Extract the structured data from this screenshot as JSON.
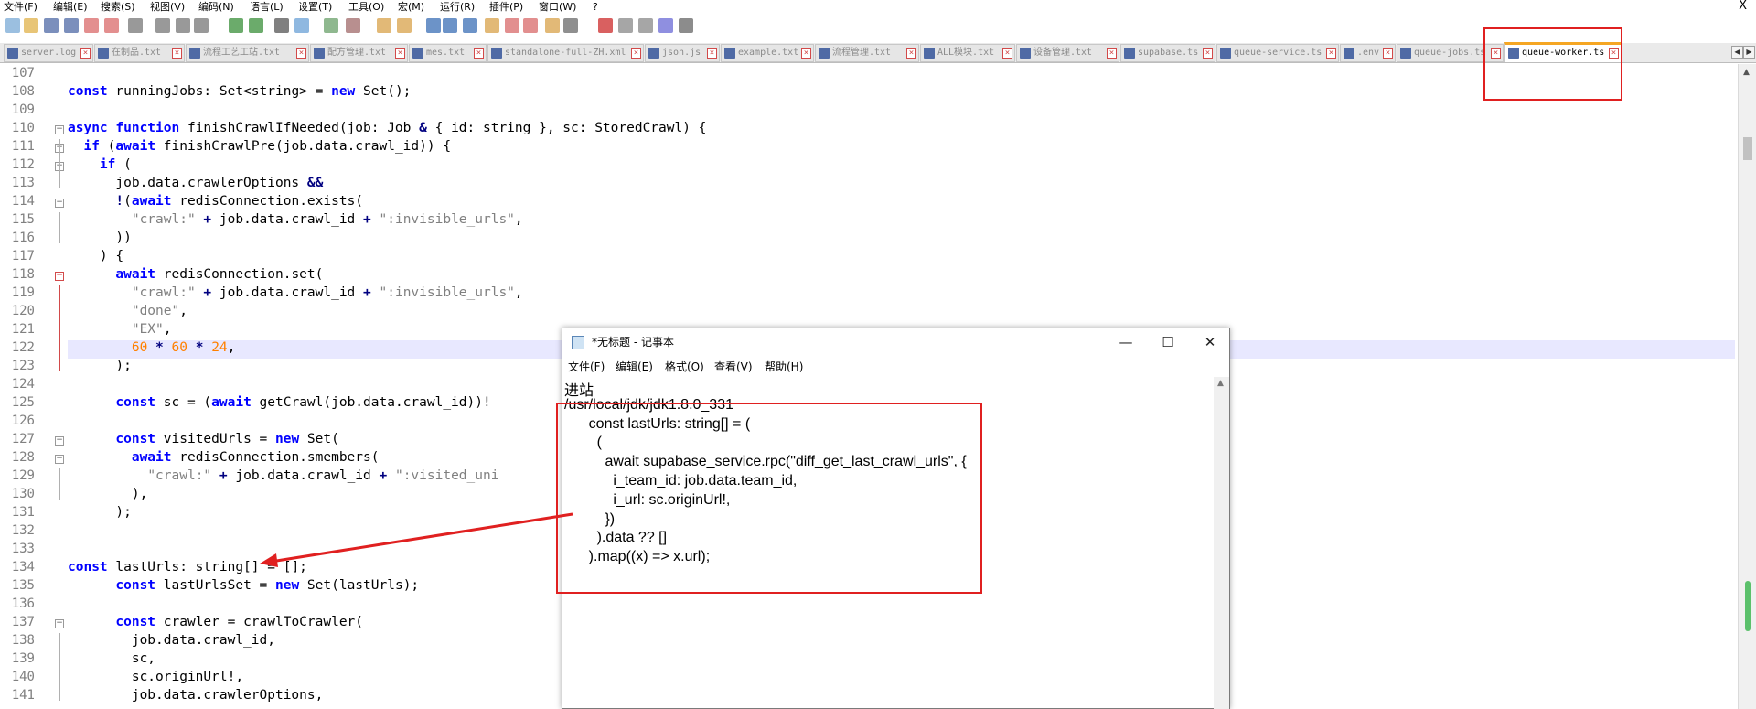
{
  "menu": {
    "items": [
      "文件(F)",
      "编辑(E)",
      "搜索(S)",
      "视图(V)",
      "编码(N)",
      "语言(L)",
      "设置(T)",
      "工具(O)",
      "宏(M)",
      "运行(R)",
      "插件(P)",
      "窗口(W)",
      "?"
    ],
    "close": "X"
  },
  "toolbar": {
    "icons": [
      "new-file-icon",
      "open-file-icon",
      "save-icon",
      "save-all-icon",
      "close-icon",
      "close-all-icon",
      "print-icon",
      "cut-icon",
      "copy-icon",
      "paste-icon",
      "undo-icon",
      "redo-icon",
      "find-icon",
      "replace-icon",
      "zoom-in-icon",
      "zoom-out-icon",
      "sync-v-icon",
      "sync-h-icon",
      "wrap-icon",
      "all-chars-icon",
      "indent-guide-icon",
      "lang-icon",
      "doc-map-icon",
      "func-list-icon",
      "folder-icon",
      "monitor-icon",
      "record-icon",
      "stop-icon",
      "play-icon",
      "play-multi-icon",
      "save-macro-icon"
    ]
  },
  "tabs": [
    {
      "label": "server.log"
    },
    {
      "label": "在制品.txt"
    },
    {
      "label": "流程工艺工站.txt"
    },
    {
      "label": "配方管理.txt"
    },
    {
      "label": "mes.txt"
    },
    {
      "label": "standalone-full-ZH.xml"
    },
    {
      "label": "json.js"
    },
    {
      "label": "example.txt"
    },
    {
      "label": "流程管理.txt"
    },
    {
      "label": "ALL模块.txt"
    },
    {
      "label": "设备管理.txt"
    },
    {
      "label": "supabase.ts"
    },
    {
      "label": "queue-service.ts"
    },
    {
      "label": ".env"
    },
    {
      "label": "queue-jobs.ts"
    },
    {
      "label": "queue-worker.ts"
    }
  ],
  "nav": {
    "left": "◀",
    "right": "▶"
  },
  "line_numbers": [
    "107",
    "108",
    "109",
    "110",
    "111",
    "112",
    "113",
    "114",
    "115",
    "116",
    "117",
    "118",
    "119",
    "120",
    "121",
    "122",
    "123",
    "124",
    "125",
    "126",
    "127",
    "128",
    "129",
    "130",
    "131",
    "132",
    "133",
    "134",
    "135",
    "136",
    "137",
    "138",
    "139",
    "140",
    "141"
  ],
  "code_lines": [
    [],
    [
      {
        "t": "const",
        "c": "kw"
      },
      {
        "t": " runningJobs: Set<string> = "
      },
      {
        "t": "new",
        "c": "kw"
      },
      {
        "t": " Set();"
      }
    ],
    [],
    [
      {
        "t": "async",
        "c": "kw"
      },
      {
        "t": " "
      },
      {
        "t": "function",
        "c": "kw"
      },
      {
        "t": " finishCrawlIfNeeded(job: Job "
      },
      {
        "t": "&",
        "c": "op"
      },
      {
        "t": " { id: string }, sc: StoredCrawl) {"
      }
    ],
    [
      {
        "t": "  "
      },
      {
        "t": "if",
        "c": "kw"
      },
      {
        "t": " ("
      },
      {
        "t": "await",
        "c": "kw"
      },
      {
        "t": " finishCrawlPre(job.data.crawl_id)) {"
      }
    ],
    [
      {
        "t": "    "
      },
      {
        "t": "if",
        "c": "kw"
      },
      {
        "t": " ("
      }
    ],
    [
      {
        "t": "      job.data.crawlerOptions "
      },
      {
        "t": "&&",
        "c": "op"
      }
    ],
    [
      {
        "t": "      "
      },
      {
        "t": "!",
        "c": "op"
      },
      {
        "t": "("
      },
      {
        "t": "await",
        "c": "kw"
      },
      {
        "t": " redisConnection.exists("
      }
    ],
    [
      {
        "t": "        "
      },
      {
        "t": "\"crawl:\"",
        "c": "str"
      },
      {
        "t": " "
      },
      {
        "t": "+",
        "c": "op"
      },
      {
        "t": " job.data.crawl_id "
      },
      {
        "t": "+",
        "c": "op"
      },
      {
        "t": " "
      },
      {
        "t": "\":invisible_urls\"",
        "c": "str"
      },
      {
        "t": ","
      }
    ],
    [
      {
        "t": "      ))"
      }
    ],
    [
      {
        "t": "    ) {"
      }
    ],
    [
      {
        "t": "      "
      },
      {
        "t": "await",
        "c": "kw"
      },
      {
        "t": " redisConnection.set("
      }
    ],
    [
      {
        "t": "        "
      },
      {
        "t": "\"crawl:\"",
        "c": "str"
      },
      {
        "t": " "
      },
      {
        "t": "+",
        "c": "op"
      },
      {
        "t": " job.data.crawl_id "
      },
      {
        "t": "+",
        "c": "op"
      },
      {
        "t": " "
      },
      {
        "t": "\":invisible_urls\"",
        "c": "str"
      },
      {
        "t": ","
      }
    ],
    [
      {
        "t": "        "
      },
      {
        "t": "\"done\"",
        "c": "str"
      },
      {
        "t": ","
      }
    ],
    [
      {
        "t": "        "
      },
      {
        "t": "\"EX\"",
        "c": "str"
      },
      {
        "t": ","
      }
    ],
    [
      {
        "t": "        "
      },
      {
        "t": "60",
        "c": "num"
      },
      {
        "t": " "
      },
      {
        "t": "*",
        "c": "op"
      },
      {
        "t": " "
      },
      {
        "t": "60",
        "c": "num"
      },
      {
        "t": " "
      },
      {
        "t": "*",
        "c": "op"
      },
      {
        "t": " "
      },
      {
        "t": "24",
        "c": "num"
      },
      {
        "t": ","
      }
    ],
    [
      {
        "t": "      );"
      }
    ],
    [],
    [
      {
        "t": "      "
      },
      {
        "t": "const",
        "c": "kw"
      },
      {
        "t": " sc = ("
      },
      {
        "t": "await",
        "c": "kw"
      },
      {
        "t": " getCrawl(job.data.crawl_id))!"
      }
    ],
    [],
    [
      {
        "t": "      "
      },
      {
        "t": "const",
        "c": "kw"
      },
      {
        "t": " visitedUrls = "
      },
      {
        "t": "new",
        "c": "kw"
      },
      {
        "t": " Set("
      }
    ],
    [
      {
        "t": "        "
      },
      {
        "t": "await",
        "c": "kw"
      },
      {
        "t": " redisConnection.smembers("
      }
    ],
    [
      {
        "t": "          "
      },
      {
        "t": "\"crawl:\"",
        "c": "str"
      },
      {
        "t": " "
      },
      {
        "t": "+",
        "c": "op"
      },
      {
        "t": " job.data.crawl_id "
      },
      {
        "t": "+",
        "c": "op"
      },
      {
        "t": " "
      },
      {
        "t": "\":visited_uni",
        "c": "str"
      }
    ],
    [
      {
        "t": "        ),"
      }
    ],
    [
      {
        "t": "      );"
      }
    ],
    [],
    [],
    [
      {
        "t": "const",
        "c": "kw"
      },
      {
        "t": " lastUrls: string[] = [];"
      }
    ],
    [
      {
        "t": "      "
      },
      {
        "t": "const",
        "c": "kw"
      },
      {
        "t": " lastUrlsSet = "
      },
      {
        "t": "new",
        "c": "kw"
      },
      {
        "t": " Set(lastUrls);"
      }
    ],
    [],
    [
      {
        "t": "      "
      },
      {
        "t": "const",
        "c": "kw"
      },
      {
        "t": " crawler = crawlToCrawler("
      }
    ],
    [
      {
        "t": "        job.data.crawl_id,"
      }
    ],
    [
      {
        "t": "        sc,"
      }
    ],
    [
      {
        "t": "        sc.originUrl!,"
      }
    ],
    [
      {
        "t": "        job.data.crawlerOptions,"
      }
    ]
  ],
  "notepad": {
    "title": "*无标题 - 记事本",
    "controls": {
      "min": "—",
      "max": "☐",
      "close": "✕"
    },
    "menu": [
      "文件(F)",
      "编辑(E)",
      "格式(O)",
      "查看(V)",
      "帮助(H)"
    ],
    "lines": [
      "进站",
      "/usr/local/jdk/jdk1.8.0_331",
      "      const lastUrls: string[] = (",
      "        (",
      "          await supabase_service.rpc(\"diff_get_last_crawl_urls\", {",
      "            i_team_id: job.data.team_id,",
      "            i_url: sc.originUrl!,",
      "          })",
      "        ).data ?? []",
      "      ).map((x) => x.url);"
    ]
  },
  "colors": {
    "annotation": "#e02020",
    "active_tab_accent": "#f5a623",
    "keyword": "#0000ff",
    "string": "#808080",
    "number": "#ff8000"
  }
}
